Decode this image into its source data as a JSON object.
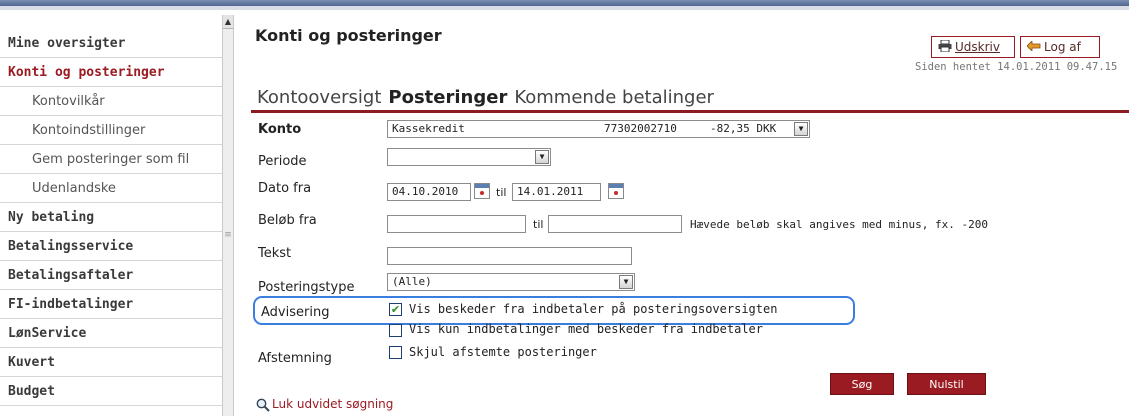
{
  "sidebar": {
    "items": [
      {
        "label": "Mine oversigter",
        "type": "main"
      },
      {
        "label": "Konti og posteringer",
        "type": "main",
        "active": true
      },
      {
        "label": "Kontovilkår",
        "type": "sub"
      },
      {
        "label": "Kontoindstillinger",
        "type": "sub"
      },
      {
        "label": "Gem posteringer som fil",
        "type": "sub"
      },
      {
        "label": "Udenlandske",
        "type": "sub"
      },
      {
        "label": "Ny betaling",
        "type": "main"
      },
      {
        "label": "Betalingsservice",
        "type": "main"
      },
      {
        "label": "Betalingsaftaler",
        "type": "main"
      },
      {
        "label": "FI-indbetalinger",
        "type": "main"
      },
      {
        "label": "LønService",
        "type": "main"
      },
      {
        "label": "Kuvert",
        "type": "main"
      },
      {
        "label": "Budget",
        "type": "main"
      }
    ]
  },
  "header": {
    "title": "Konti og posteringer",
    "print_label": "Udskriv",
    "logout_label": "Log af",
    "fetched": "Siden hentet 14.01.2011 09.47.15"
  },
  "tabs": [
    {
      "label": "Kontooversigt",
      "active": false
    },
    {
      "label": "Posteringer",
      "active": true
    },
    {
      "label": "Kommende betalinger",
      "active": false
    }
  ],
  "form": {
    "konto_label": "Konto",
    "konto_name": "Kassekredit",
    "konto_number": "77302002710",
    "konto_amount": "-82,35 DKK",
    "periode_label": "Periode",
    "periode_value": "",
    "dato_fra_label": "Dato fra",
    "dato_fra": "04.10.2010",
    "til_label": "til",
    "dato_til": "14.01.2011",
    "belob_fra_label": "Beløb fra",
    "belob_fra": "",
    "belob_til": "",
    "belob_hint": "Hævede beløb skal angives med minus, fx. -200",
    "tekst_label": "Tekst",
    "tekst_value": "",
    "posteringstype_label": "Posteringstype",
    "posteringstype_value": "(Alle)",
    "advisering_label": "Advisering",
    "vis_beskeder": "Vis beskeder fra indbetaler på posteringsoversigten",
    "vis_beskeder_checked": true,
    "vis_kun": "Vis kun indbetalinger med beskeder fra indbetaler",
    "vis_kun_checked": false,
    "afstemning_label": "Afstemning",
    "skjul_afstemte": "Skjul afstemte posteringer",
    "skjul_afstemte_checked": false,
    "search_button": "Søg",
    "reset_button": "Nulstil",
    "close_search": "Luk udvidet søgning"
  },
  "colors": {
    "brand_red": "#9a1b22",
    "highlight_blue": "#3a7fe0"
  }
}
